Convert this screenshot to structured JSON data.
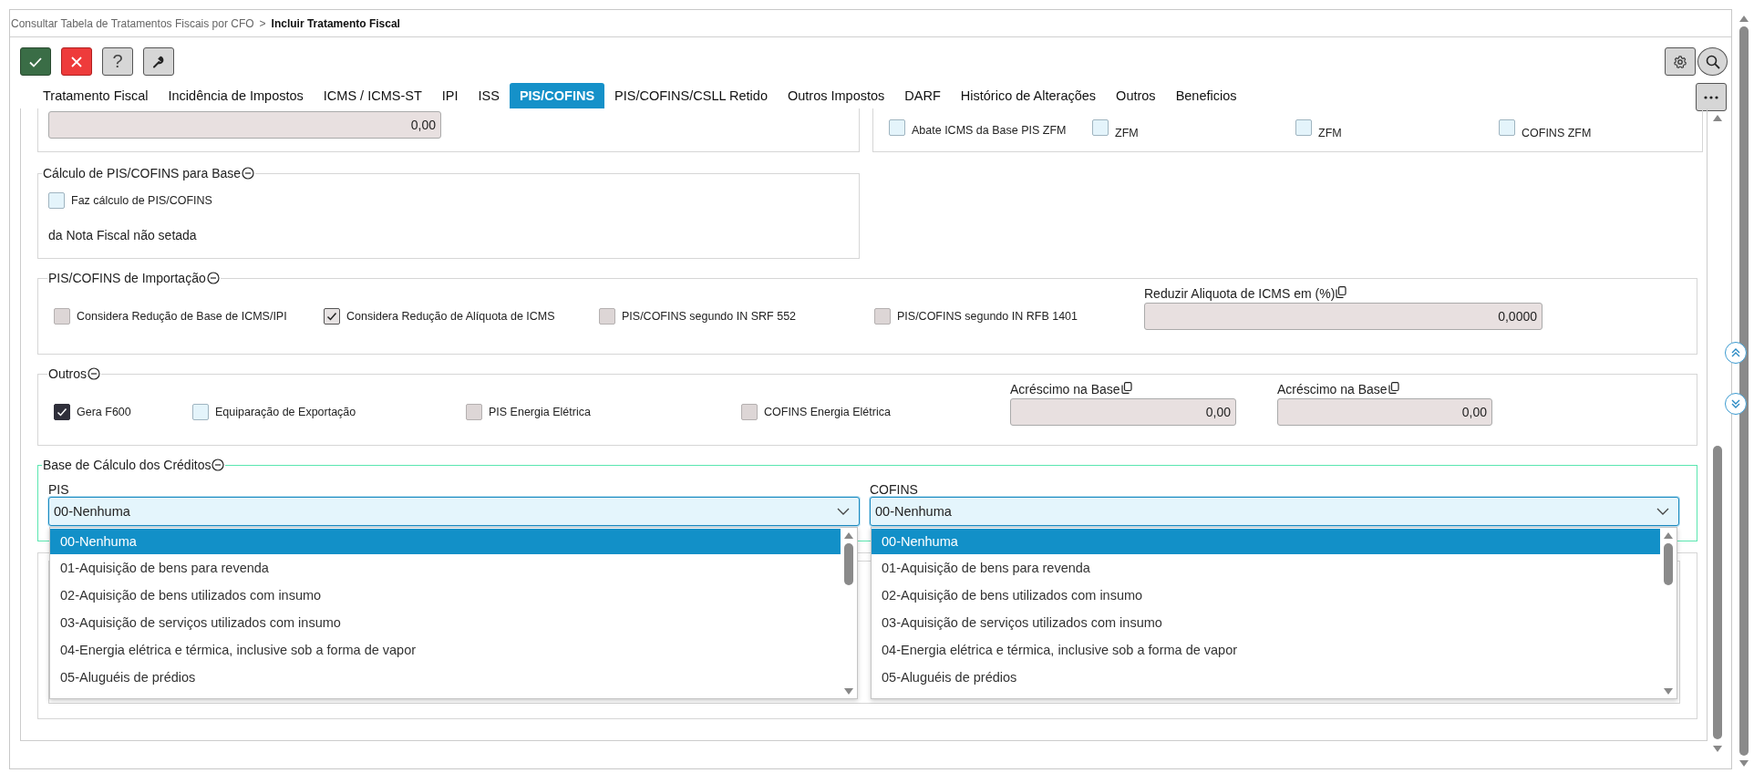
{
  "breadcrumb": {
    "separator": ">",
    "items": [
      {
        "text": "Consultar Tabela de Tratamentos Fiscais por CFO",
        "current": false
      },
      {
        "text": "Incluir Tratamento Fiscal",
        "current": true
      }
    ]
  },
  "toolbar": {
    "left": [
      {
        "kind": "confirm"
      },
      {
        "kind": "cancel"
      },
      {
        "kind": "help",
        "label": "?"
      },
      {
        "kind": "tools"
      }
    ],
    "right": [
      {
        "kind": "settings"
      },
      {
        "kind": "search"
      }
    ]
  },
  "tabs": [
    {
      "label": "Tratamento Fiscal",
      "selected": false
    },
    {
      "label": "Incidência de Impostos",
      "selected": false
    },
    {
      "label": "ICMS / ICMS-ST",
      "selected": false
    },
    {
      "label": "IPI",
      "selected": false
    },
    {
      "label": "ISS",
      "selected": false
    },
    {
      "label": "PIS/COFINS",
      "selected": true
    },
    {
      "label": "PIS/COFINS/CSLL Retido",
      "selected": false
    },
    {
      "label": "Outros Impostos",
      "selected": false
    },
    {
      "label": "DARF",
      "selected": false
    },
    {
      "label": "Histórico de Alterações",
      "selected": false
    },
    {
      "label": "Outros",
      "selected": false
    },
    {
      "label": "Beneficios",
      "selected": false
    }
  ],
  "top_partial": {
    "value": "0,00",
    "checkboxes": [
      {
        "label": "Abate ICMS da Base PIS ZFM",
        "checked": false,
        "disabled": false
      },
      {
        "label": "ZFM",
        "checked": false,
        "disabled": false
      },
      {
        "label": "ZFM",
        "checked": false,
        "disabled": false
      },
      {
        "label": "COFINS ZFM",
        "checked": false,
        "disabled": false
      }
    ]
  },
  "calculo": {
    "title": "Cálculo de PIS/COFINS para Base",
    "checkbox": {
      "label": "Faz cálculo de PIS/COFINS",
      "checked": false,
      "disabled": false
    },
    "note": "da Nota Fiscal não setada"
  },
  "importacao": {
    "title": "PIS/COFINS de Importação",
    "checkboxes": [
      {
        "label": "Considera Redução de Base de ICMS/IPI",
        "checked": false,
        "disabled": true
      },
      {
        "label": "Considera Redução de Alíquota de ICMS",
        "checked": true,
        "disabled": true
      },
      {
        "label": "PIS/COFINS segundo IN SRF 552",
        "checked": false,
        "disabled": true
      },
      {
        "label": "PIS/COFINS segundo IN RFB 1401",
        "checked": false,
        "disabled": true
      }
    ],
    "fields": [
      {
        "label": "Reduzir Aliquota de ICMS em (%)",
        "value": "0,0000"
      }
    ]
  },
  "outros": {
    "title": "Outros",
    "checkboxes": [
      {
        "label": "Gera F600",
        "checked": true,
        "disabled": false
      },
      {
        "label": "Equiparação de Exportação",
        "checked": false,
        "disabled": false
      },
      {
        "label": "PIS Energia Elétrica",
        "checked": false,
        "disabled": true
      },
      {
        "label": "COFINS Energia Elétrica",
        "checked": false,
        "disabled": true
      }
    ],
    "fields": [
      {
        "label": "Acréscimo na Base",
        "value": "0,00"
      },
      {
        "label": "Acréscimo na Base",
        "value": "0,00"
      }
    ]
  },
  "creditos": {
    "title": "Base de Cálculo dos Créditos",
    "selects": [
      {
        "label": "PIS",
        "value": "00-Nenhuma",
        "expanded": true,
        "options": [
          {
            "text": "00-Nenhuma",
            "selected": true
          },
          {
            "text": "01-Aquisição de bens para revenda",
            "selected": false
          },
          {
            "text": "02-Aquisição de bens utilizados com insumo",
            "selected": false
          },
          {
            "text": "03-Aquisição de serviços utilizados com insumo",
            "selected": false
          },
          {
            "text": "04-Energia elétrica e térmica, inclusive sob a forma de vapor",
            "selected": false
          },
          {
            "text": "05-Aluguéis de prédios",
            "selected": false
          }
        ]
      },
      {
        "label": "COFINS",
        "value": "00-Nenhuma",
        "expanded": true,
        "options": [
          {
            "text": "00-Nenhuma",
            "selected": true
          },
          {
            "text": "01-Aquisição de bens para revenda",
            "selected": false
          },
          {
            "text": "02-Aquisição de bens utilizados com insumo",
            "selected": false
          },
          {
            "text": "03-Aquisição de serviços utilizados com insumo",
            "selected": false
          },
          {
            "text": "04-Energia elétrica e térmica, inclusive sob a forma de vapor",
            "selected": false
          },
          {
            "text": "05-Aluguéis de prédios",
            "selected": false
          }
        ]
      }
    ]
  }
}
